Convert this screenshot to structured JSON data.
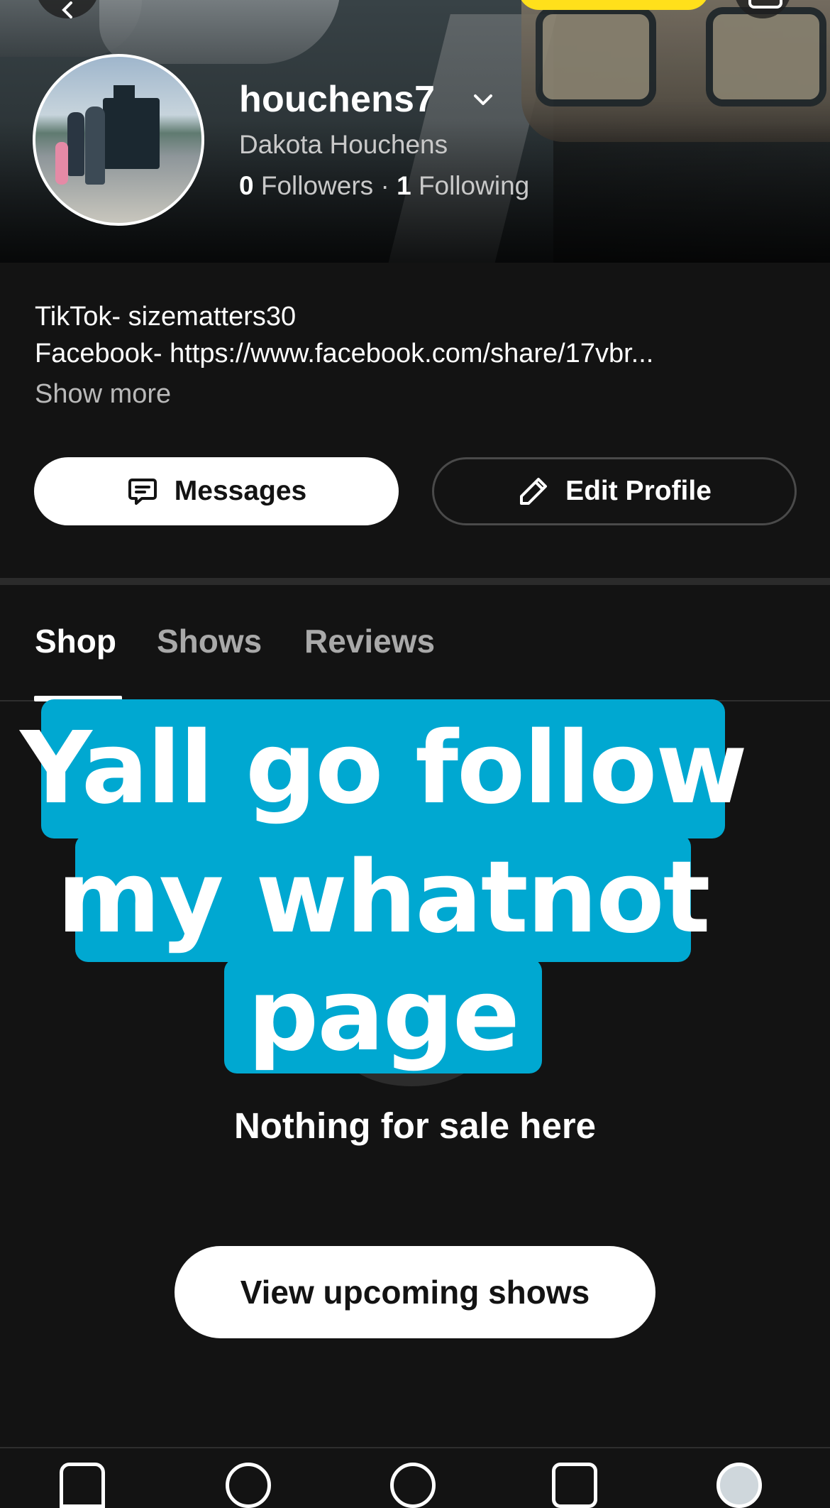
{
  "profile": {
    "username": "houchens7",
    "display_name": "Dakota Houchens",
    "followers_count": "0",
    "followers_label": "Followers",
    "separator": "·",
    "following_count": "1",
    "following_label": "Following"
  },
  "bio": {
    "line1": "TikTok- sizematters30",
    "line2": "Facebook- https://www.facebook.com/share/17vbr...",
    "show_more": "Show more"
  },
  "actions": {
    "messages_label": "Messages",
    "edit_profile_label": "Edit Profile"
  },
  "tabs": [
    {
      "label": "Shop",
      "active": true
    },
    {
      "label": "Shows",
      "active": false
    },
    {
      "label": "Reviews",
      "active": false
    }
  ],
  "empty_state": {
    "title": "Nothing for sale here",
    "button_label": "View upcoming shows"
  },
  "overlay_caption": {
    "line1": "Yall go follow",
    "line2": "my whatnot",
    "line3": "page"
  },
  "colors": {
    "background": "#131313",
    "caption_bg": "#00a8d1",
    "accent_yellow": "#ffe01b"
  },
  "icons": {
    "back": "chevron-left-icon",
    "dropdown": "chevron-down-icon",
    "messages": "chat-bubble-icon",
    "edit": "pencil-icon"
  }
}
